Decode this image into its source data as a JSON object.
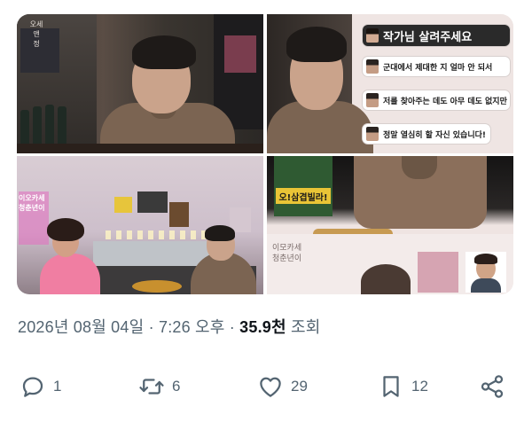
{
  "media": {
    "tile1": {
      "sign_text": "오세\n앤\n정"
    },
    "tile2": {
      "captions": [
        "작가님 살려주세요",
        "군대에서 제대한 지 얼마 안 되서",
        "저를 찾아주는 데도 아무 데도 없지만",
        "정말 열심히 할 자신 있습니다!"
      ]
    },
    "tile3": {
      "neon_text": "이오카세\n청춘년이"
    },
    "tile4": {
      "sign_word": "오!삼겹빌라!",
      "label": "이모카세\n청춘년이"
    }
  },
  "meta": {
    "date": "2026년 08월 04일",
    "sep1": " · ",
    "time": "7:26 오후",
    "sep2": " · ",
    "views_count": "35.9천",
    "views_label": " 조회"
  },
  "actions": {
    "reply_count": "1",
    "retweet_count": "6",
    "like_count": "29",
    "bookmark_count": "12"
  },
  "icons": {
    "reply": "reply-icon",
    "retweet": "retweet-icon",
    "like": "heart-icon",
    "bookmark": "bookmark-icon",
    "share": "share-icon"
  },
  "colors": {
    "muted_text": "#536471",
    "primary_text": "#0f1419"
  }
}
